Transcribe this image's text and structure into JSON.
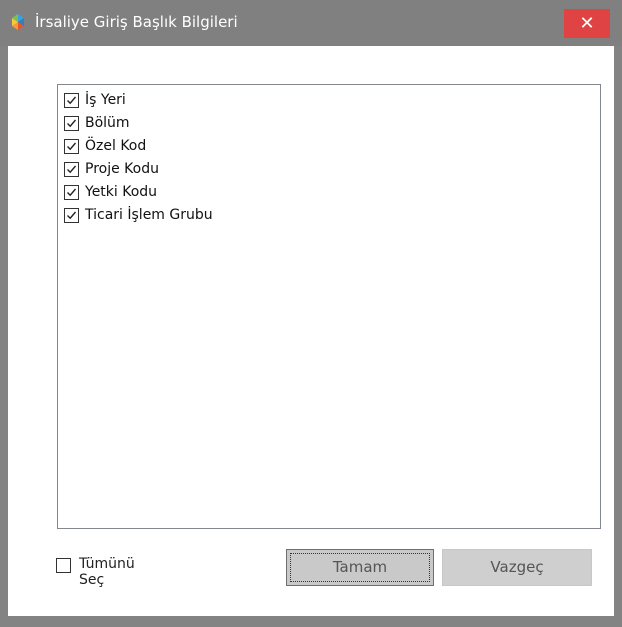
{
  "window": {
    "title": "İrsaliye Giriş Başlık Bilgileri",
    "close_glyph": "✕",
    "icon": "app-logo-icon"
  },
  "list": {
    "items": [
      {
        "label": "İş Yeri",
        "checked": true
      },
      {
        "label": "Bölüm",
        "checked": true
      },
      {
        "label": "Özel Kod",
        "checked": true
      },
      {
        "label": "Proje Kodu",
        "checked": true
      },
      {
        "label": "Yetki Kodu",
        "checked": true
      },
      {
        "label": "Ticari İşlem Grubu",
        "checked": true
      }
    ]
  },
  "footer": {
    "select_all_label": "Tümünü Seç",
    "select_all_checked": false,
    "ok_label": "Tamam",
    "cancel_label": "Vazgeç"
  },
  "colors": {
    "titlebar": "#808080",
    "close_button": "#e04343",
    "button_face": "#cfcfcf"
  }
}
